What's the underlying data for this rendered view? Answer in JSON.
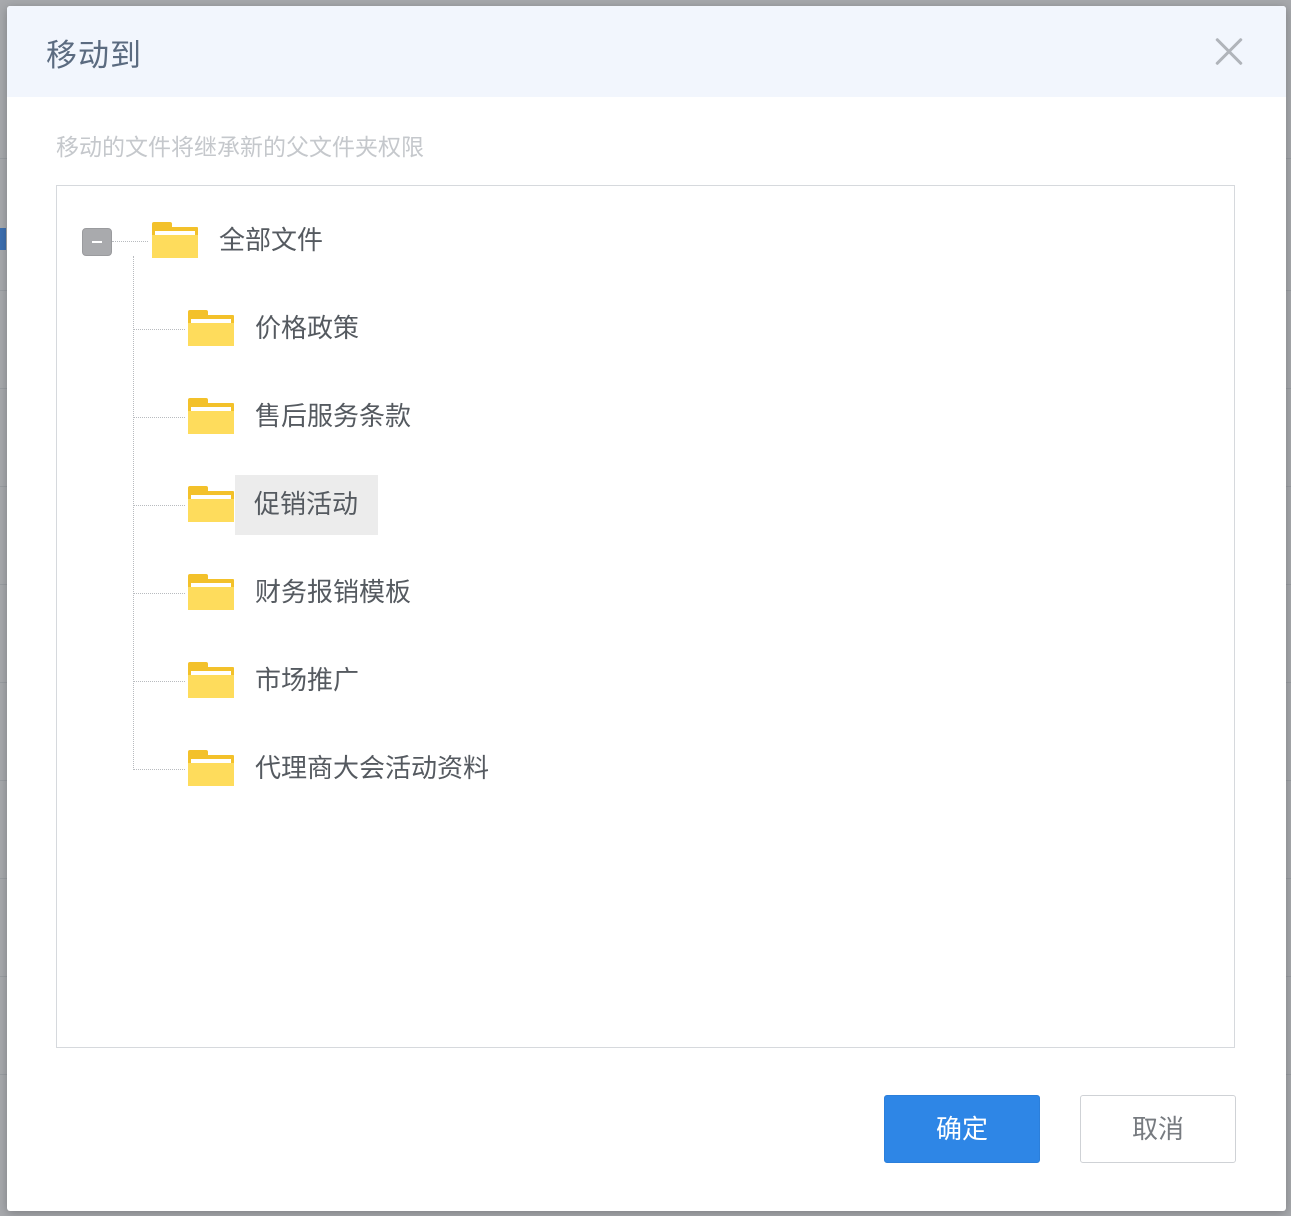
{
  "dialog": {
    "title": "移动到",
    "hint": "移动的文件将继承新的父文件夹权限",
    "tree": {
      "root": {
        "label": "全部文件",
        "expanded": true
      },
      "children": [
        {
          "label": "价格政策"
        },
        {
          "label": "售后服务条款"
        },
        {
          "label": "促销活动",
          "selected": true
        },
        {
          "label": "财务报销模板"
        },
        {
          "label": "市场推广"
        },
        {
          "label": "代理商大会活动资料"
        }
      ]
    },
    "buttons": {
      "confirm": "确定",
      "cancel": "取消"
    }
  },
  "colors": {
    "primary": "#2e86e6",
    "folder_dark": "#f3c12a",
    "folder_light": "#fedc5c",
    "header_bg": "#f2f6fd"
  },
  "icons": {
    "close": "close-icon",
    "folder": "folder-icon",
    "collapse": "minus-square-icon"
  }
}
